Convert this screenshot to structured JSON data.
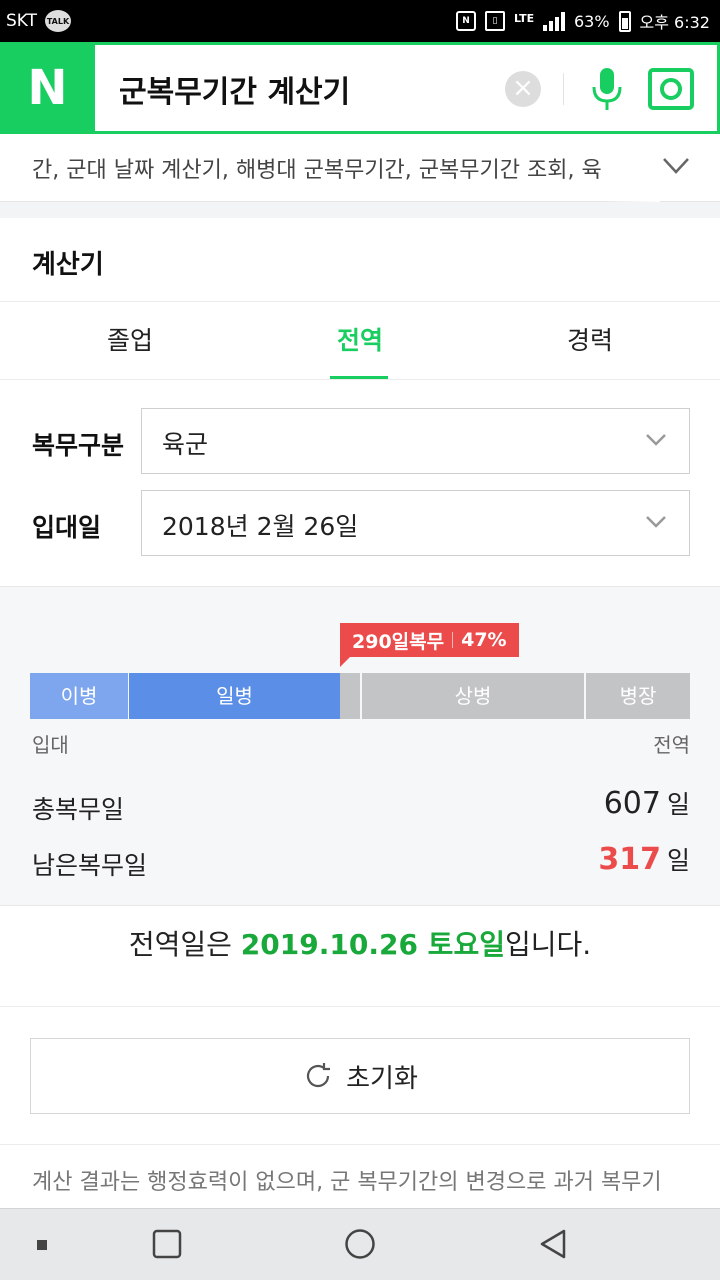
{
  "status_bar": {
    "carrier": "SKT",
    "talk_badge": "TALK",
    "lte": "LTE",
    "battery": "63%",
    "time": "오후 6:32"
  },
  "search": {
    "logo": "N",
    "query": "군복무기간 계산기",
    "brand_color": "#19ce60"
  },
  "suggestions": {
    "text": "간, 군대 날짜 계산기, 해병대 군복무기간, 군복무기간 조회, 육"
  },
  "calculator": {
    "title": "계산기",
    "tabs": [
      {
        "label": "졸업",
        "active": false
      },
      {
        "label": "전역",
        "active": true
      },
      {
        "label": "경력",
        "active": false
      }
    ],
    "branch": {
      "label": "복무구분",
      "value": "육군"
    },
    "enlist": {
      "label": "입대일",
      "value": "2018년 2월 26일"
    },
    "progress": {
      "served_label": "290일복무",
      "percent_label": "47%",
      "percent": 47,
      "segments": [
        "이병",
        "일병",
        "상병",
        "병장"
      ],
      "start_label": "입대",
      "end_label": "전역"
    },
    "total": {
      "label": "총복무일",
      "value": "607",
      "unit": "일"
    },
    "remaining": {
      "label": "남은복무일",
      "value": "317",
      "unit": "일"
    },
    "discharge": {
      "prefix": "전역일은 ",
      "date": "2019.10.26 토요일",
      "suffix": "입니다."
    },
    "reset_label": "초기화",
    "disclaimer": "계산 결과는 행정효력이 없으며, 군 복무기간의 변경으로 과거 복무기"
  }
}
